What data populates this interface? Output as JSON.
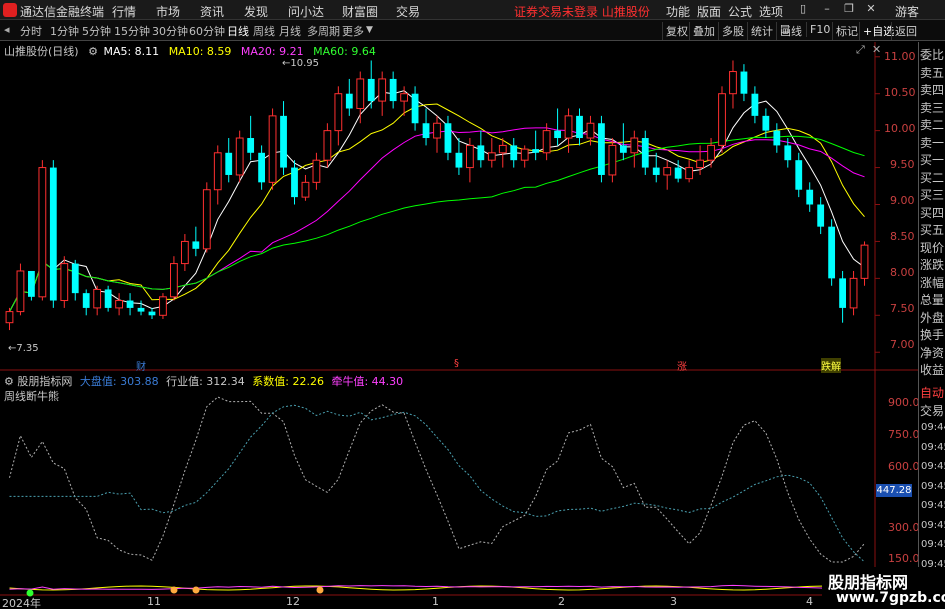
{
  "menubar": {
    "app_title": "通达信金融终端",
    "items": [
      "行情",
      "市场",
      "资讯",
      "发现",
      "问小达",
      "财富圈",
      "交易"
    ],
    "warning": "证券交易未登录  山推股份",
    "right_items": [
      "功能",
      "版面",
      "公式",
      "选项"
    ],
    "guest": "游客"
  },
  "toolbar": {
    "periods": [
      "分时",
      "1分钟",
      "5分钟",
      "15分钟",
      "30分钟",
      "60分钟",
      "日线",
      "周线",
      "月线",
      "多周期",
      "更多"
    ],
    "active_period": "日线",
    "right_buttons": [
      "复权",
      "叠加",
      "多股",
      "统计",
      "画线",
      "F10",
      "标记",
      "+自选",
      "返回"
    ]
  },
  "main": {
    "title": "山推股份(日线)",
    "ma": [
      {
        "label": "MA5: 8.11",
        "color": "#ffffff"
      },
      {
        "label": "MA10: 8.59",
        "color": "#ffff00"
      },
      {
        "label": "MA20: 9.21",
        "color": "#ff00ff"
      },
      {
        "label": "MA60: 9.64",
        "color": "#00ff00"
      }
    ],
    "high_label": "10.95",
    "low_label": "7.35",
    "price_axis": [
      "11.00",
      "10.50",
      "10.00",
      "9.50",
      "9.00",
      "8.50",
      "8.00",
      "7.50",
      "7.00"
    ],
    "event_tags": [
      "财",
      "§",
      "涨",
      "跌解"
    ]
  },
  "indicator": {
    "name": "股朋指标网",
    "values": [
      {
        "label": "大盘值: 303.88",
        "color": "#3a7bd5"
      },
      {
        "label": "行业值: 312.34",
        "color": "#c8c8c8"
      },
      {
        "label": "系数值: 22.26",
        "color": "#ffff00"
      },
      {
        "label": "牵牛值: 44.30",
        "color": "#ff40ff"
      }
    ],
    "subtitle": "周线断牛熊",
    "axis": [
      "900.0",
      "750.0",
      "600.0",
      "450.0",
      "300.0",
      "150.0"
    ],
    "current_value": "447.28"
  },
  "date_axis": [
    "2024年",
    "11",
    "12",
    "1",
    "2",
    "3",
    "4"
  ],
  "right_panel": {
    "labels": [
      "委比",
      "卖五",
      "卖四",
      "卖三",
      "卖二",
      "卖一",
      "买一",
      "买二",
      "买三",
      "买四",
      "买五",
      "现价",
      "涨跌",
      "涨幅",
      "总量",
      "外盘",
      "换手",
      "净资",
      "收益"
    ],
    "auto_label": "自动",
    "trade_label": "交易",
    "times": [
      "09:44",
      "09:45",
      "09:45",
      "09:45",
      "09:45",
      "09:45",
      "09:45",
      "09:45",
      "09:45"
    ]
  },
  "watermark": {
    "line1": "股朋指标网",
    "line2": "www.7gpzb.com"
  },
  "colors": {
    "up": "#ff3030",
    "down": "#00ffff",
    "ma5": "#ffffff",
    "ma10": "#ffff00",
    "ma20": "#ff00ff",
    "ma60": "#00ff00"
  },
  "chart_data": {
    "type": "candlestick",
    "title": "山推股份(日线)",
    "ylim": [
      6.8,
      11.2
    ],
    "candles": [
      [
        7.4,
        7.6,
        7.3,
        7.55
      ],
      [
        7.55,
        8.2,
        7.5,
        8.1
      ],
      [
        8.1,
        8.0,
        7.7,
        7.75
      ],
      [
        7.75,
        9.6,
        7.7,
        9.5
      ],
      [
        9.5,
        9.6,
        7.6,
        7.7
      ],
      [
        7.7,
        8.3,
        7.6,
        8.2
      ],
      [
        8.2,
        8.25,
        7.7,
        7.8
      ],
      [
        7.8,
        7.85,
        7.5,
        7.6
      ],
      [
        7.6,
        7.9,
        7.5,
        7.85
      ],
      [
        7.85,
        7.9,
        7.55,
        7.6
      ],
      [
        7.6,
        7.8,
        7.5,
        7.7
      ],
      [
        7.7,
        7.8,
        7.5,
        7.6
      ],
      [
        7.6,
        7.7,
        7.5,
        7.55
      ],
      [
        7.55,
        7.6,
        7.45,
        7.5
      ],
      [
        7.5,
        7.8,
        7.45,
        7.75
      ],
      [
        7.75,
        8.3,
        7.7,
        8.2
      ],
      [
        8.2,
        8.6,
        8.1,
        8.5
      ],
      [
        8.5,
        8.7,
        8.3,
        8.4
      ],
      [
        8.4,
        9.3,
        8.35,
        9.2
      ],
      [
        9.2,
        9.8,
        9.0,
        9.7
      ],
      [
        9.7,
        9.9,
        9.3,
        9.4
      ],
      [
        9.4,
        10.0,
        9.3,
        9.9
      ],
      [
        9.9,
        10.2,
        9.6,
        9.7
      ],
      [
        9.7,
        9.8,
        9.2,
        9.3
      ],
      [
        9.3,
        10.3,
        9.2,
        10.2
      ],
      [
        10.2,
        10.4,
        9.4,
        9.5
      ],
      [
        9.5,
        9.6,
        9.0,
        9.1
      ],
      [
        9.1,
        9.4,
        9.05,
        9.3
      ],
      [
        9.3,
        9.7,
        9.2,
        9.6
      ],
      [
        9.6,
        10.1,
        9.5,
        10.0
      ],
      [
        10.0,
        10.6,
        9.8,
        10.5
      ],
      [
        10.5,
        10.7,
        10.2,
        10.3
      ],
      [
        10.3,
        10.8,
        10.1,
        10.7
      ],
      [
        10.7,
        10.95,
        10.3,
        10.4
      ],
      [
        10.4,
        10.8,
        10.2,
        10.7
      ],
      [
        10.7,
        10.8,
        10.3,
        10.4
      ],
      [
        10.4,
        10.6,
        10.2,
        10.5
      ],
      [
        10.5,
        10.6,
        10.0,
        10.1
      ],
      [
        10.1,
        10.3,
        9.8,
        9.9
      ],
      [
        9.9,
        10.2,
        9.7,
        10.1
      ],
      [
        10.1,
        10.2,
        9.6,
        9.7
      ],
      [
        9.7,
        9.9,
        9.4,
        9.5
      ],
      [
        9.5,
        9.9,
        9.3,
        9.8
      ],
      [
        9.8,
        10.0,
        9.5,
        9.6
      ],
      [
        9.6,
        9.9,
        9.5,
        9.7
      ],
      [
        9.7,
        9.9,
        9.5,
        9.8
      ],
      [
        9.8,
        9.9,
        9.5,
        9.6
      ],
      [
        9.6,
        9.8,
        9.5,
        9.75
      ],
      [
        9.75,
        10.0,
        9.6,
        9.7
      ],
      [
        9.7,
        10.1,
        9.6,
        10.0
      ],
      [
        10.0,
        10.3,
        9.8,
        9.9
      ],
      [
        9.9,
        10.3,
        9.7,
        10.2
      ],
      [
        10.2,
        10.3,
        9.8,
        9.9
      ],
      [
        9.9,
        10.2,
        9.8,
        10.1
      ],
      [
        10.1,
        10.2,
        9.3,
        9.4
      ],
      [
        9.4,
        9.9,
        9.3,
        9.8
      ],
      [
        9.8,
        10.1,
        9.6,
        9.7
      ],
      [
        9.7,
        10.0,
        9.5,
        9.9
      ],
      [
        9.9,
        10.0,
        9.4,
        9.5
      ],
      [
        9.5,
        9.7,
        9.3,
        9.4
      ],
      [
        9.4,
        9.6,
        9.2,
        9.5
      ],
      [
        9.5,
        9.6,
        9.3,
        9.35
      ],
      [
        9.35,
        9.6,
        9.3,
        9.5
      ],
      [
        9.5,
        9.8,
        9.4,
        9.6
      ],
      [
        9.6,
        9.9,
        9.5,
        9.8
      ],
      [
        9.8,
        10.6,
        9.7,
        10.5
      ],
      [
        10.5,
        10.95,
        10.3,
        10.8
      ],
      [
        10.8,
        10.9,
        10.4,
        10.5
      ],
      [
        10.5,
        10.6,
        10.1,
        10.2
      ],
      [
        10.2,
        10.3,
        9.9,
        10.0
      ],
      [
        10.0,
        10.1,
        9.7,
        9.8
      ],
      [
        9.8,
        9.9,
        9.5,
        9.6
      ],
      [
        9.6,
        9.7,
        9.1,
        9.2
      ],
      [
        9.2,
        9.3,
        8.9,
        9.0
      ],
      [
        9.0,
        9.1,
        8.6,
        8.7
      ],
      [
        8.7,
        8.8,
        7.9,
        8.0
      ],
      [
        8.0,
        8.1,
        7.4,
        7.6
      ],
      [
        7.6,
        8.1,
        7.5,
        8.0
      ],
      [
        8.0,
        8.5,
        7.9,
        8.45
      ]
    ]
  }
}
